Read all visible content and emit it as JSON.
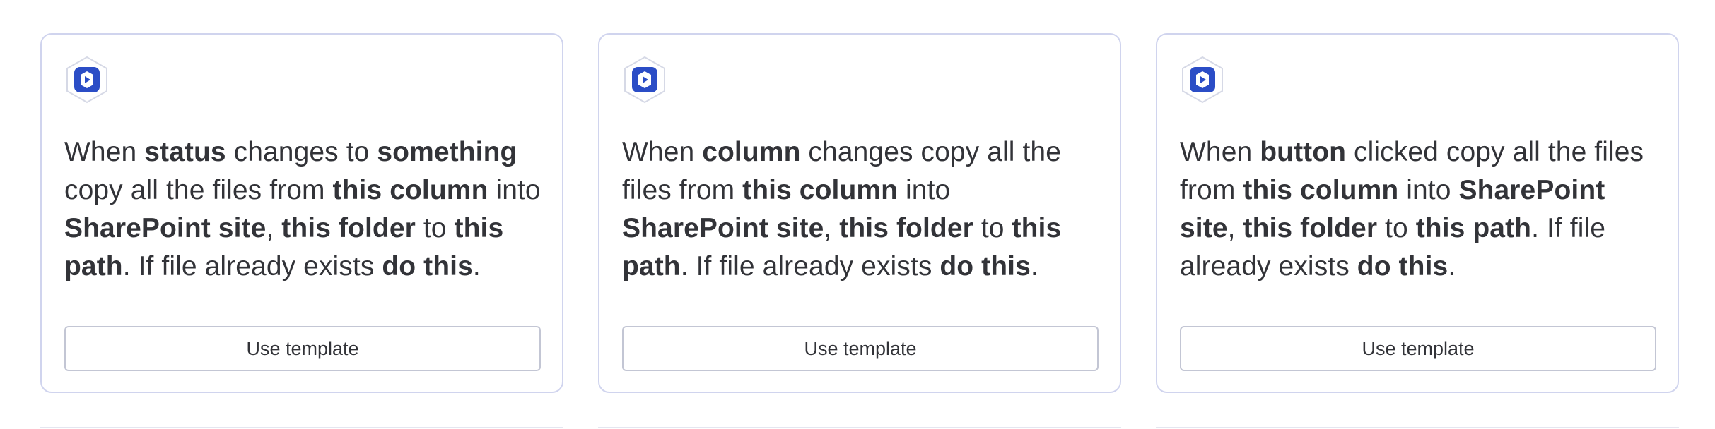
{
  "accent_color": "#2b4dc6",
  "cards": [
    {
      "icon": "app-logo-icon",
      "segments": [
        {
          "t": "When ",
          "b": false
        },
        {
          "t": "status",
          "b": true
        },
        {
          "t": " changes to ",
          "b": false
        },
        {
          "t": "something",
          "b": true
        },
        {
          "t": " copy all the files from ",
          "b": false
        },
        {
          "t": "this column",
          "b": true
        },
        {
          "t": " into ",
          "b": false
        },
        {
          "t": "SharePoint site",
          "b": true
        },
        {
          "t": ", ",
          "b": false
        },
        {
          "t": "this folder",
          "b": true
        },
        {
          "t": " to ",
          "b": false
        },
        {
          "t": "this path",
          "b": true
        },
        {
          "t": ". If file already exists ",
          "b": false
        },
        {
          "t": "do this",
          "b": true
        },
        {
          "t": ".",
          "b": false
        }
      ],
      "button_label": "Use template"
    },
    {
      "icon": "app-logo-icon",
      "segments": [
        {
          "t": "When ",
          "b": false
        },
        {
          "t": "column",
          "b": true
        },
        {
          "t": " changes copy all the files from ",
          "b": false
        },
        {
          "t": "this column",
          "b": true
        },
        {
          "t": " into ",
          "b": false
        },
        {
          "t": "SharePoint site",
          "b": true
        },
        {
          "t": ", ",
          "b": false
        },
        {
          "t": "this folder",
          "b": true
        },
        {
          "t": " to ",
          "b": false
        },
        {
          "t": "this path",
          "b": true
        },
        {
          "t": ". If file already exists ",
          "b": false
        },
        {
          "t": "do this",
          "b": true
        },
        {
          "t": ".",
          "b": false
        }
      ],
      "button_label": "Use template"
    },
    {
      "icon": "app-logo-icon",
      "segments": [
        {
          "t": "When ",
          "b": false
        },
        {
          "t": "button",
          "b": true
        },
        {
          "t": " clicked copy all the files from ",
          "b": false
        },
        {
          "t": "this column",
          "b": true
        },
        {
          "t": " into ",
          "b": false
        },
        {
          "t": "SharePoint site",
          "b": true
        },
        {
          "t": ", ",
          "b": false
        },
        {
          "t": "this folder",
          "b": true
        },
        {
          "t": " to ",
          "b": false
        },
        {
          "t": "this path",
          "b": true
        },
        {
          "t": ". If file already exists ",
          "b": false
        },
        {
          "t": "do this",
          "b": true
        },
        {
          "t": ".",
          "b": false
        }
      ],
      "button_label": "Use template"
    }
  ]
}
